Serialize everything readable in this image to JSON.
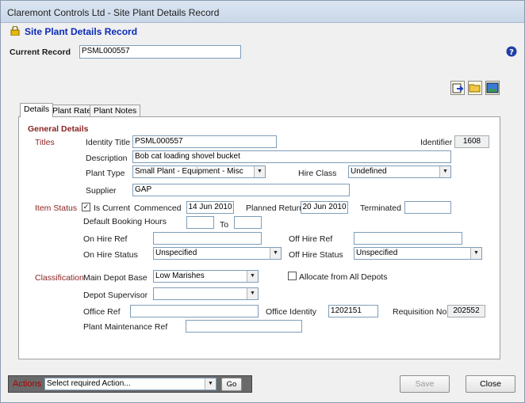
{
  "window": {
    "title": "Claremont Controls Ltd - Site Plant Details Record"
  },
  "header": {
    "title": "Site Plant Details Record",
    "current_record_label": "Current Record",
    "current_record_value": "PSML000557"
  },
  "tabs": [
    {
      "label": "Details"
    },
    {
      "label": "Plant Rates"
    },
    {
      "label": "Plant Notes"
    }
  ],
  "general": {
    "heading": "General Details",
    "titles_section": "Titles",
    "identity_title_label": "Identity Title",
    "identity_title_value": "PSML000557",
    "identifier_label": "Identifier",
    "identifier_value": "1608",
    "description_label": "Description",
    "description_value": "Bob cat loading shovel bucket",
    "plant_type_label": "Plant Type",
    "plant_type_value": "Small Plant - Equipment - Misc",
    "hire_class_label": "Hire Class",
    "hire_class_value": "Undefined",
    "supplier_label": "Supplier",
    "supplier_value": "GAP"
  },
  "item_status": {
    "section": "Item Status",
    "is_current_label": "Is Current",
    "is_current_checked": true,
    "commenced_label": "Commenced",
    "commenced_value": "14 Jun 2010",
    "planned_return_label": "Planned Return",
    "planned_return_value": "20 Jun 2010",
    "terminated_label": "Terminated",
    "terminated_value": "",
    "default_booking_label": "Default Booking Hours",
    "to_label": "To",
    "on_hire_ref_label": "On Hire Ref",
    "off_hire_ref_label": "Off Hire Ref",
    "on_hire_status_label": "On Hire Status",
    "on_hire_status_value": "Unspecified",
    "off_hire_status_label": "Off Hire Status",
    "off_hire_status_value": "Unspecified"
  },
  "classification": {
    "section": "Classification",
    "main_depot_label": "Main Depot Base",
    "main_depot_value": "Low Marishes",
    "allocate_label": "Allocate from All Depots",
    "depot_supervisor_label": "Depot Supervisor",
    "depot_supervisor_value": "",
    "office_ref_label": "Office Ref",
    "office_identity_label": "Office Identity",
    "office_identity_value": "1202151",
    "requisition_label": "Requisition No",
    "requisition_value": "202552",
    "plant_maint_label": "Plant Maintenance Ref"
  },
  "footer": {
    "actions_label": "Actions",
    "actions_value": "Select required Action...",
    "go_label": "Go",
    "save_label": "Save",
    "close_label": "Close"
  },
  "icons": [
    "lock-icon",
    "help-icon",
    "export-icon",
    "open-folder-icon",
    "picture-icon",
    "check-icon",
    "dropdown-arrow-icon"
  ],
  "colors": {
    "section": "#8b2323",
    "title": "#0a2ab8",
    "actions_bar": "#6a6a6a",
    "actions_text": "#b00000"
  }
}
